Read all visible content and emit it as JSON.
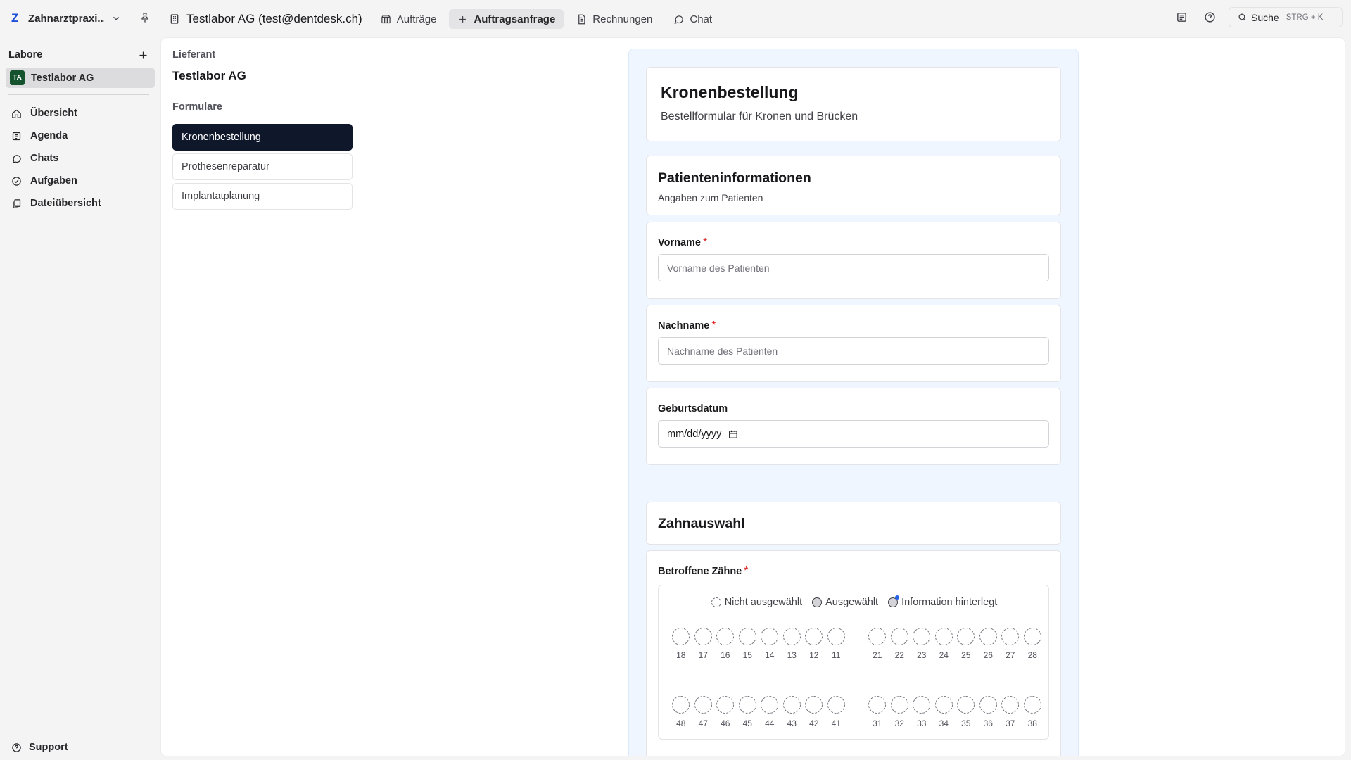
{
  "workspace": {
    "logo": "Z",
    "name": "Zahnarztpraxi..."
  },
  "topnav": {
    "lab_title": "Testlabor AG (test@dentdesk.ch)",
    "items": [
      {
        "label": "Aufträge",
        "icon": "box-icon"
      },
      {
        "label": "Auftragsanfrage",
        "icon": "plus-icon",
        "active": true
      },
      {
        "label": "Rechnungen",
        "icon": "document-icon"
      },
      {
        "label": "Chat",
        "icon": "chat-icon"
      }
    ],
    "search_label": "Suche",
    "search_shortcut": "STRG + K"
  },
  "sidebar": {
    "heading": "Labore",
    "lab": {
      "initials": "TA",
      "name": "Testlabor AG"
    },
    "items": [
      {
        "label": "Übersicht",
        "icon": "home-icon"
      },
      {
        "label": "Agenda",
        "icon": "agenda-icon"
      },
      {
        "label": "Chats",
        "icon": "chat-icon"
      },
      {
        "label": "Aufgaben",
        "icon": "check-circle-icon"
      },
      {
        "label": "Dateiübersicht",
        "icon": "files-icon"
      }
    ],
    "support": "Support"
  },
  "left_panel": {
    "supplier_label": "Lieferant",
    "supplier_value": "Testlabor AG",
    "forms_label": "Formulare",
    "forms": [
      {
        "label": "Kronenbestellung",
        "active": true
      },
      {
        "label": "Prothesenreparatur"
      },
      {
        "label": "Implantatplanung"
      }
    ]
  },
  "form": {
    "title": "Kronenbestellung",
    "description": "Bestellformular für Kronen und Brücken",
    "patient_section": {
      "title": "Patienteninformationen",
      "description": "Angaben zum Patienten"
    },
    "fields": {
      "vorname": {
        "label": "Vorname",
        "required_mark": "*",
        "placeholder": "Vorname des Patienten"
      },
      "nachname": {
        "label": "Nachname",
        "required_mark": "*",
        "placeholder": "Nachname des Patienten"
      },
      "geburtsdatum": {
        "label": "Geburtsdatum",
        "placeholder": "mm/dd/yyyy"
      }
    },
    "teeth_section": {
      "title": "Zahnauswahl",
      "label": "Betroffene Zähne",
      "required_mark": "*",
      "legend": {
        "not_selected": "Nicht ausgewählt",
        "selected": "Ausgewählt",
        "info": "Information hinterlegt"
      },
      "upper_right": [
        "18",
        "17",
        "16",
        "15",
        "14",
        "13",
        "12",
        "11"
      ],
      "upper_left": [
        "21",
        "22",
        "23",
        "24",
        "25",
        "26",
        "27",
        "28"
      ],
      "lower_right": [
        "48",
        "47",
        "46",
        "45",
        "44",
        "43",
        "42",
        "41"
      ],
      "lower_left": [
        "31",
        "32",
        "33",
        "34",
        "35",
        "36",
        "37",
        "38"
      ]
    }
  },
  "colors": {
    "accent": "#0f172a",
    "required": "#dc2626",
    "canvas": "#eff6ff",
    "info_dot": "#2563eb"
  }
}
